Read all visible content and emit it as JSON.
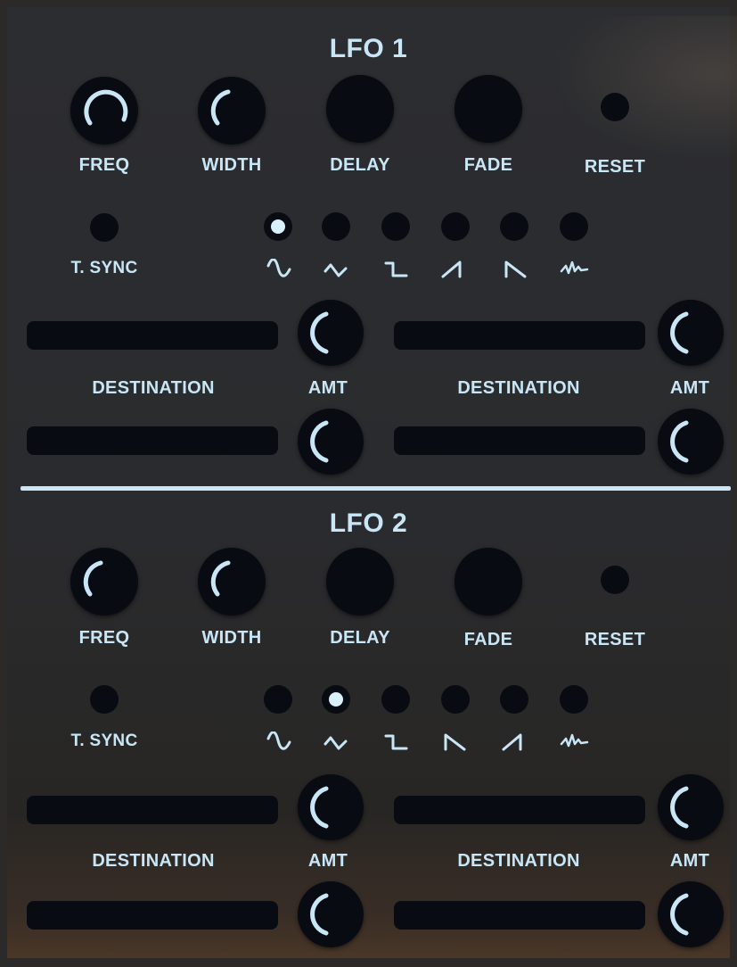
{
  "accent_color": "#c8e6f6",
  "lfo1": {
    "title": "LFO 1",
    "knobs": {
      "freq": "FREQ",
      "width": "WIDTH",
      "delay": "DELAY",
      "fade": "FADE"
    },
    "reset_label": "RESET",
    "tsync_label": "T. SYNC",
    "waveforms": [
      "sine-wave-icon",
      "triangle-wave-icon",
      "square-wave-icon",
      "saw-up-wave-icon",
      "saw-down-wave-icon",
      "random-wave-icon"
    ],
    "selected_waveform": 0,
    "destination_label": "DESTINATION",
    "amt_label": "AMT"
  },
  "lfo2": {
    "title": "LFO 2",
    "knobs": {
      "freq": "FREQ",
      "width": "WIDTH",
      "delay": "DELAY",
      "fade": "FADE"
    },
    "reset_label": "RESET",
    "tsync_label": "T. SYNC",
    "waveforms": [
      "sine-wave-icon",
      "triangle-wave-icon",
      "square-wave-icon",
      "saw-down-wave-icon",
      "saw-up-wave-icon",
      "random-wave-icon"
    ],
    "selected_waveform": 1,
    "destination_label": "DESTINATION",
    "amt_label": "AMT"
  }
}
